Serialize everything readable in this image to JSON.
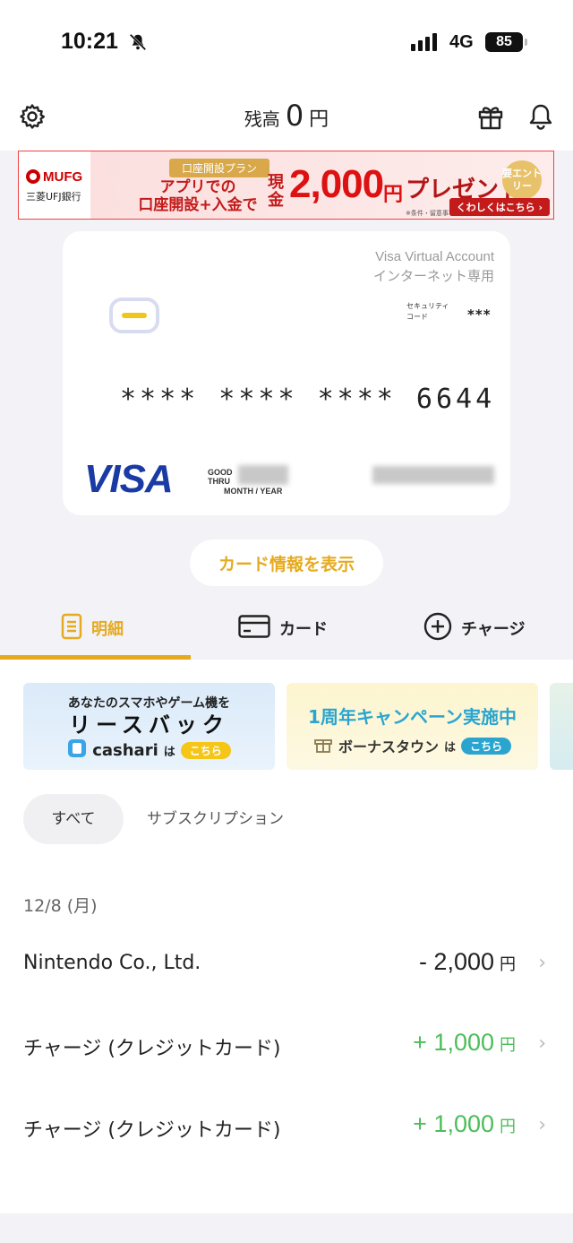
{
  "status_bar": {
    "time": "10:21",
    "network": "4G",
    "battery": "85"
  },
  "header": {
    "balance_label": "残高",
    "balance_value": "0",
    "currency": "円"
  },
  "banner": {
    "bank_name": "MUFG",
    "bank_full": "三菱UFJ銀行",
    "tag": "口座開設プラン",
    "main_line1": "アプリでの",
    "main_line2": "口座開設+入金で",
    "cash_label": "現金",
    "amount": "2,000",
    "currency": "円",
    "present": "プレゼント",
    "entry": "要エントリー",
    "note": "※条件・留意事項があります",
    "link": "くわしくはこちら ›"
  },
  "card": {
    "type_line1": "Visa Virtual Account",
    "type_line2": "インターネット専用",
    "security_label_1": "セキュリティ",
    "security_label_2": "コード",
    "security_value": "***",
    "number": "**** **** **** 6644",
    "brand": "VISA",
    "good_thru_1": "GOOD",
    "good_thru_2": "THRU",
    "month_year": "MONTH / YEAR"
  },
  "show_card_button": "カード情報を表示",
  "tabs": [
    {
      "label": "明細",
      "icon": "document-icon"
    },
    {
      "label": "カード",
      "icon": "card-icon"
    },
    {
      "label": "チャージ",
      "icon": "plus-circle-icon"
    }
  ],
  "promos": {
    "p1_line1": "あなたのスマホやゲーム機を",
    "p1_line2": "リースバック",
    "p1_brand": "cashari",
    "p1_wa": "は",
    "p1_pill": "こちら",
    "p2_line1": "1周年キャンペーン実施中",
    "p2_brand": "ボーナスタウン",
    "p2_wa": "は",
    "p2_pill": "こちら"
  },
  "filters": {
    "all": "すべて",
    "subscription": "サブスクリプション"
  },
  "date_header": "12/8 (月)",
  "transactions": [
    {
      "name": "Nintendo Co., Ltd.",
      "amount": "- 2,000",
      "currency": "円"
    },
    {
      "name": "チャージ (クレジットカード)",
      "amount": "+ 1,000",
      "currency": "円"
    },
    {
      "name": "チャージ (クレジットカード)",
      "amount": "+ 1,000",
      "currency": "円"
    }
  ],
  "colors": {
    "accent": "#e6aa1f",
    "positive": "#4cbd5a",
    "visa": "#1a3ba3",
    "banner_red": "#c31a1a"
  }
}
